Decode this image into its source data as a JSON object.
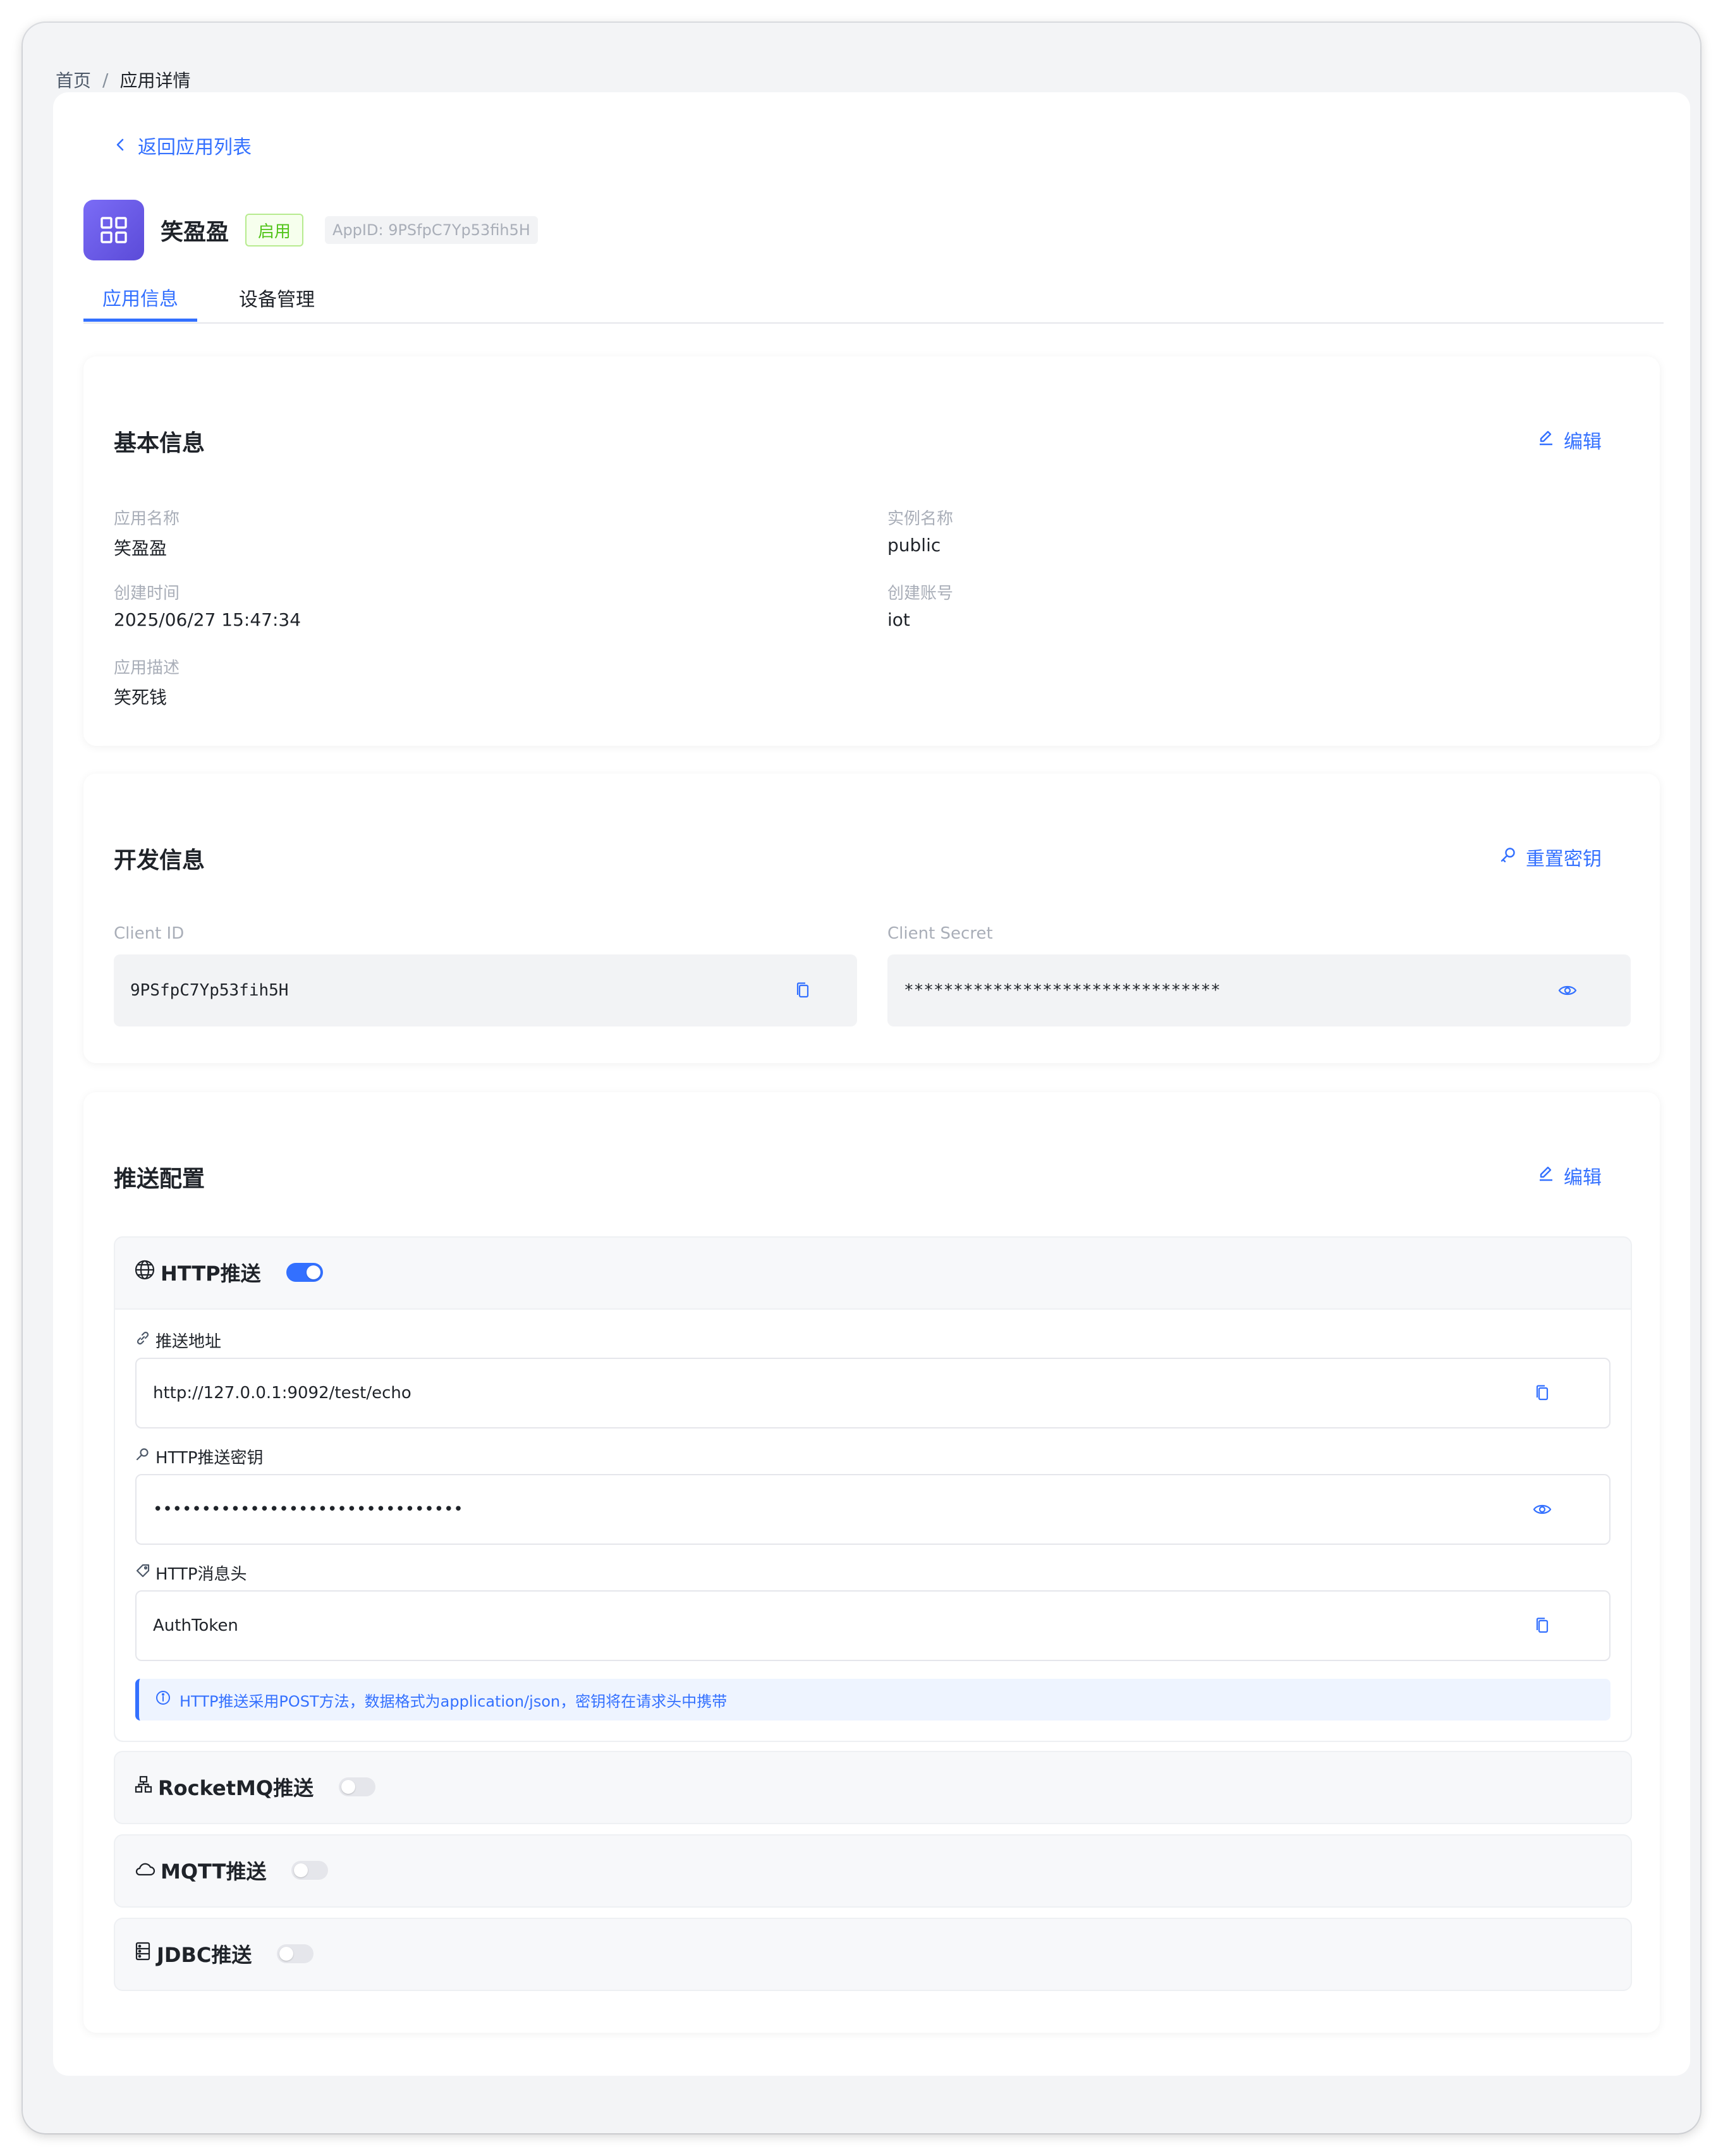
{
  "breadcrumb": {
    "home": "首页",
    "separator": "/",
    "current": "应用详情"
  },
  "back_link": {
    "label": "返回应用列表"
  },
  "app": {
    "name": "笑盈盈",
    "status": "启用",
    "app_id": "AppID: 9PSfpC7Yp53fih5H"
  },
  "tabs": [
    {
      "label": "应用信息",
      "active": true
    },
    {
      "label": "设备管理",
      "active": false
    }
  ],
  "basic_info": {
    "title": "基本信息",
    "edit_label": "编辑",
    "fields": {
      "app_name_label": "应用名称",
      "app_name_value": "笑盈盈",
      "instance_label": "实例名称",
      "instance_value": "public",
      "created_label": "创建时间",
      "created_value": "2025/06/27 15:47:34",
      "account_label": "创建账号",
      "account_value": "iot",
      "desc_label": "应用描述",
      "desc_value": "笑死钱"
    }
  },
  "dev_info": {
    "title": "开发信息",
    "reset_label": "重置密钥",
    "client_id_label": "Client ID",
    "client_id_value": "9PSfpC7Yp53fih5H",
    "client_secret_label": "Client Secret",
    "client_secret_value": "********************************"
  },
  "push_config": {
    "title": "推送配置",
    "edit_label": "编辑",
    "http": {
      "title": "HTTP推送",
      "enabled": true,
      "url_label": "推送地址",
      "url_value": "http://127.0.0.1:9092/test/echo",
      "secret_label": "HTTP推送密钥",
      "secret_value": "••••••••••••••••••••••••••••••••",
      "header_label": "HTTP消息头",
      "header_value": "AuthToken",
      "info": "HTTP推送采用POST方法，数据格式为application/json，密钥将在请求头中携带"
    },
    "rocketmq": {
      "title": "RocketMQ推送",
      "enabled": false
    },
    "mqtt": {
      "title": "MQTT推送",
      "enabled": false
    },
    "jdbc": {
      "title": "JDBC推送",
      "enabled": false
    }
  },
  "colors": {
    "accent": "#3370ff",
    "success": "#52c41a",
    "app_icon": "#6a5be6"
  }
}
